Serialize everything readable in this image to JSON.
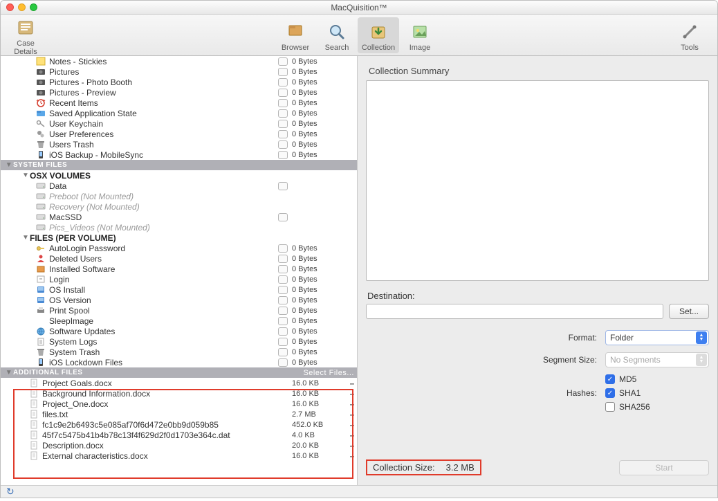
{
  "window": {
    "title": "MacQuisition™"
  },
  "toolbar": {
    "left": [
      {
        "id": "case-details",
        "label": "Case Details"
      }
    ],
    "center": [
      {
        "id": "browser",
        "label": "Browser"
      },
      {
        "id": "search",
        "label": "Search"
      },
      {
        "id": "collection",
        "label": "Collection",
        "active": true
      },
      {
        "id": "image",
        "label": "Image"
      }
    ],
    "right": [
      {
        "id": "tools",
        "label": "Tools"
      }
    ]
  },
  "tree": [
    {
      "type": "item",
      "indent": 44,
      "icon": "note-yellow",
      "label": "Notes - Stickies",
      "chk": true,
      "size": "0 Bytes"
    },
    {
      "type": "item",
      "indent": 44,
      "icon": "camera",
      "label": "Pictures",
      "chk": true,
      "size": "0 Bytes"
    },
    {
      "type": "item",
      "indent": 44,
      "icon": "camera",
      "label": "Pictures - Photo Booth",
      "chk": true,
      "size": "0 Bytes"
    },
    {
      "type": "item",
      "indent": 44,
      "icon": "camera",
      "label": "Pictures - Preview",
      "chk": true,
      "size": "0 Bytes"
    },
    {
      "type": "item",
      "indent": 44,
      "icon": "clock-red",
      "label": "Recent Items",
      "chk": true,
      "size": "0 Bytes"
    },
    {
      "type": "item",
      "indent": 44,
      "icon": "folder-blue",
      "label": "Saved Application State",
      "chk": true,
      "size": "0 Bytes"
    },
    {
      "type": "item",
      "indent": 44,
      "icon": "keys",
      "label": "User Keychain",
      "chk": true,
      "size": "0 Bytes"
    },
    {
      "type": "item",
      "indent": 44,
      "icon": "gears",
      "label": "User Preferences",
      "chk": true,
      "size": "0 Bytes"
    },
    {
      "type": "item",
      "indent": 44,
      "icon": "trash",
      "label": "Users Trash",
      "chk": true,
      "size": "0 Bytes"
    },
    {
      "type": "item",
      "indent": 44,
      "icon": "phone",
      "label": "iOS Backup - MobileSync",
      "chk": true,
      "size": "0 Bytes"
    },
    {
      "type": "section",
      "label": "SYSTEM FILES"
    },
    {
      "type": "header",
      "indent": 24,
      "disclosure": "▼",
      "label": "OSX VOLUMES"
    },
    {
      "type": "item",
      "indent": 44,
      "icon": "drive",
      "label": "Data",
      "chk": true,
      "size": ""
    },
    {
      "type": "item",
      "indent": 44,
      "icon": "drive",
      "label": "Preboot (Not Mounted)",
      "muted": true,
      "size": ""
    },
    {
      "type": "item",
      "indent": 44,
      "icon": "drive",
      "label": "Recovery (Not Mounted)",
      "muted": true,
      "size": ""
    },
    {
      "type": "item",
      "indent": 44,
      "icon": "drive",
      "label": "MacSSD",
      "chk": true,
      "size": ""
    },
    {
      "type": "item",
      "indent": 44,
      "icon": "drive",
      "label": "Pics_Videos (Not Mounted)",
      "muted": true,
      "size": ""
    },
    {
      "type": "header",
      "indent": 24,
      "disclosure": "▼",
      "label": "FILES (PER VOLUME)"
    },
    {
      "type": "item",
      "indent": 44,
      "icon": "key",
      "label": "AutoLogin Password",
      "chk": true,
      "size": "0 Bytes"
    },
    {
      "type": "item",
      "indent": 44,
      "icon": "user-red",
      "label": "Deleted Users",
      "chk": true,
      "size": "0 Bytes"
    },
    {
      "type": "item",
      "indent": 44,
      "icon": "box-orange",
      "label": "Installed Software",
      "chk": true,
      "size": "0 Bytes"
    },
    {
      "type": "item",
      "indent": 44,
      "icon": "login",
      "label": "Login",
      "chk": true,
      "size": "0 Bytes"
    },
    {
      "type": "item",
      "indent": 44,
      "icon": "os-blue",
      "label": "OS Install",
      "chk": true,
      "size": "0 Bytes"
    },
    {
      "type": "item",
      "indent": 44,
      "icon": "os-blue",
      "label": "OS Version",
      "chk": true,
      "size": "0 Bytes"
    },
    {
      "type": "item",
      "indent": 44,
      "icon": "printer",
      "label": "Print Spool",
      "chk": true,
      "size": "0 Bytes"
    },
    {
      "type": "item",
      "indent": 44,
      "icon": "moon",
      "label": "SleepImage",
      "chk": true,
      "size": "0 Bytes"
    },
    {
      "type": "item",
      "indent": 44,
      "icon": "globe",
      "label": "Software Updates",
      "chk": true,
      "size": "0 Bytes"
    },
    {
      "type": "item",
      "indent": 44,
      "icon": "log",
      "label": "System Logs",
      "chk": true,
      "size": "0 Bytes"
    },
    {
      "type": "item",
      "indent": 44,
      "icon": "trash",
      "label": "System Trash",
      "chk": true,
      "size": "0 Bytes"
    },
    {
      "type": "item",
      "indent": 44,
      "icon": "phone",
      "label": "iOS Lockdown Files",
      "chk": true,
      "size": "0 Bytes"
    },
    {
      "type": "section",
      "label": "ADDITIONAL FILES",
      "selectFiles": "Select Files..."
    },
    {
      "type": "file",
      "indent": 34,
      "icon": "doc",
      "label": "Project Goals.docx",
      "size": "16.0 KB",
      "remove": "–"
    },
    {
      "type": "file",
      "indent": 34,
      "icon": "doc",
      "label": "Background Information.docx",
      "size": "16.0 KB",
      "remove": "–"
    },
    {
      "type": "file",
      "indent": 34,
      "icon": "doc",
      "label": "Project_One.docx",
      "size": "16.0 KB",
      "remove": "–"
    },
    {
      "type": "file",
      "indent": 34,
      "icon": "doc",
      "label": "files.txt",
      "size": "2.7 MB",
      "remove": "–"
    },
    {
      "type": "file",
      "indent": 34,
      "icon": "doc",
      "label": "fc1c9e2b6493c5e085af70f6d472e0bb9d059b85",
      "size": "452.0 KB",
      "remove": "–"
    },
    {
      "type": "file",
      "indent": 34,
      "icon": "doc",
      "label": "45f7c5475b41b4b78c13f4f629d2f0d1703e364c.dat",
      "size": "4.0 KB",
      "remove": "–"
    },
    {
      "type": "file",
      "indent": 34,
      "icon": "doc",
      "label": "Description.docx",
      "size": "20.0 KB",
      "remove": "–"
    },
    {
      "type": "file",
      "indent": 34,
      "icon": "doc",
      "label": "External characteristics.docx",
      "size": "16.0 KB",
      "remove": "–"
    }
  ],
  "summary": {
    "title": "Collection Summary",
    "destinationLabel": "Destination:",
    "destinationValue": "",
    "setLabel": "Set...",
    "formatLabel": "Format:",
    "formatValue": "Folder",
    "segmentLabel": "Segment Size:",
    "segmentValue": "No Segments",
    "hashesLabel": "Hashes:",
    "hashes": {
      "md5": "MD5",
      "sha1": "SHA1",
      "sha256": "SHA256"
    },
    "collectionSizeLabel": "Collection Size:",
    "collectionSize": "3.2 MB",
    "startLabel": "Start"
  }
}
